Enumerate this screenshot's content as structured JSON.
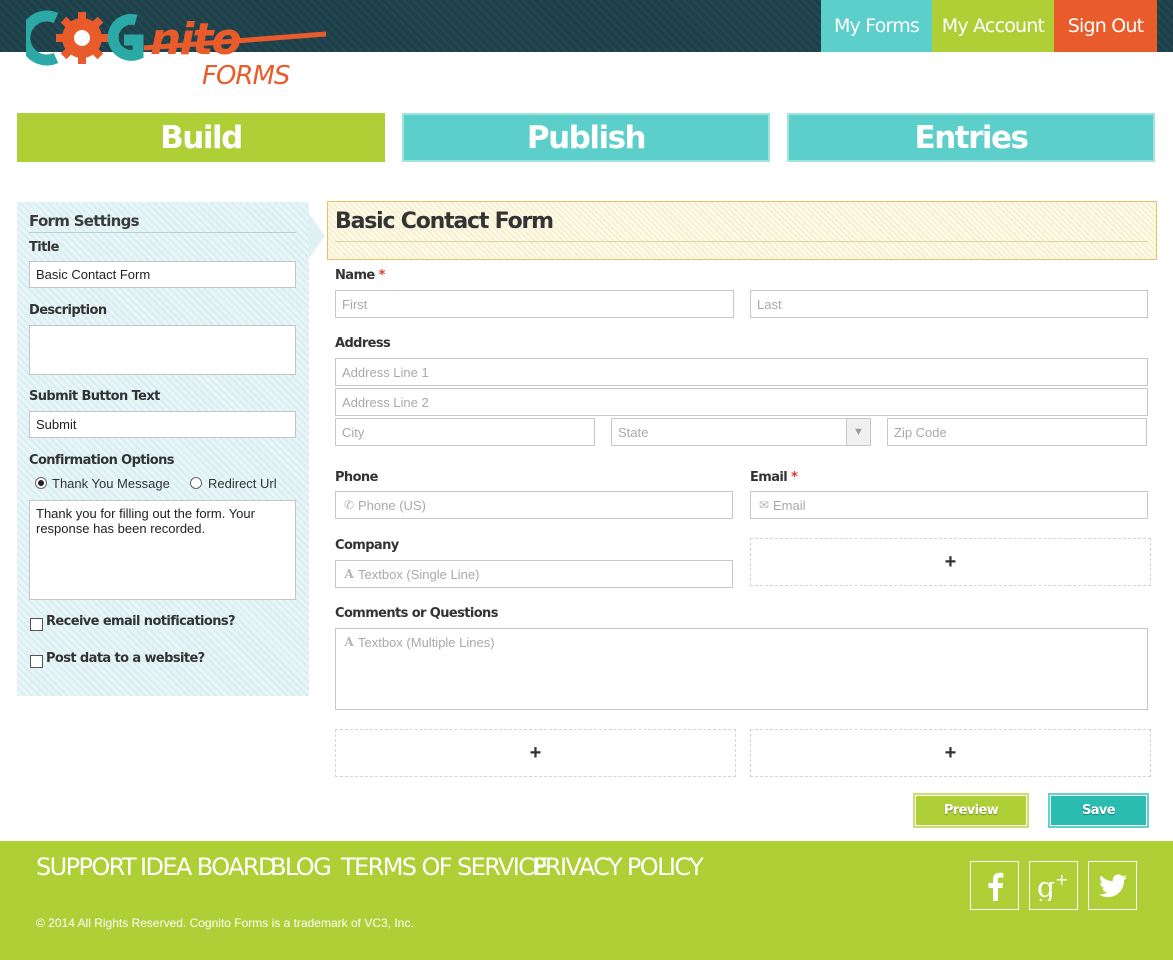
{
  "brand": {
    "logo_text": "COGNITO",
    "logo_sub": "FORMS",
    "colors": {
      "teal": "#5ccfca",
      "lime": "#afcf37",
      "orange": "#ea5b2b",
      "dark": "#1e3f4a"
    }
  },
  "nav": {
    "my_forms": "My Forms",
    "my_account": "My Account",
    "sign_out": "Sign Out"
  },
  "tabs": {
    "build": "Build",
    "publish": "Publish",
    "entries": "Entries",
    "active": "Build"
  },
  "settings": {
    "heading": "Form Settings",
    "title_label": "Title",
    "title_value": "Basic Contact Form",
    "description_label": "Description",
    "description_value": "",
    "submit_label": "Submit Button Text",
    "submit_value": "Submit",
    "confirmation_label": "Confirmation Options",
    "option_thank_you": "Thank You Message",
    "option_redirect": "Redirect Url",
    "selected_option": "Thank You Message",
    "confirmation_message": "Thank you for filling out the form. Your response has been recorded.",
    "email_notifications_label": "Receive email notifications?",
    "email_notifications_checked": false,
    "post_data_label": "Post data to a website?",
    "post_data_checked": false
  },
  "form": {
    "title": "Basic Contact Form",
    "required_mark": "*",
    "name": {
      "label": "Name",
      "first": "First",
      "last": "Last"
    },
    "address": {
      "label": "Address",
      "line1": "Address Line 1",
      "line2": "Address Line 2",
      "city": "City",
      "state": "State",
      "zip": "Zip Code"
    },
    "phone": {
      "label": "Phone",
      "placeholder": "Phone (US)",
      "icon": "phone-icon"
    },
    "email": {
      "label": "Email",
      "placeholder": "Email",
      "icon": "envelope-icon"
    },
    "company": {
      "label": "Company",
      "placeholder": "Textbox (Single Line)",
      "icon": "text-icon"
    },
    "comments": {
      "label": "Comments or Questions",
      "placeholder": "Textbox (Multiple Lines)",
      "icon": "text-icon"
    },
    "add_symbol": "+",
    "preview_button": "Preview",
    "save_button": "Save"
  },
  "footer": {
    "links": [
      "SUPPORT",
      "IDEA BOARD",
      "BLOG",
      "TERMS OF SERVICE",
      "PRIVACY POLICY"
    ],
    "copyright": "© 2014 All Rights Reserved. Cognito Forms is a trademark of VC3, Inc.",
    "social": [
      "facebook-icon",
      "google-plus-icon",
      "twitter-icon"
    ]
  }
}
